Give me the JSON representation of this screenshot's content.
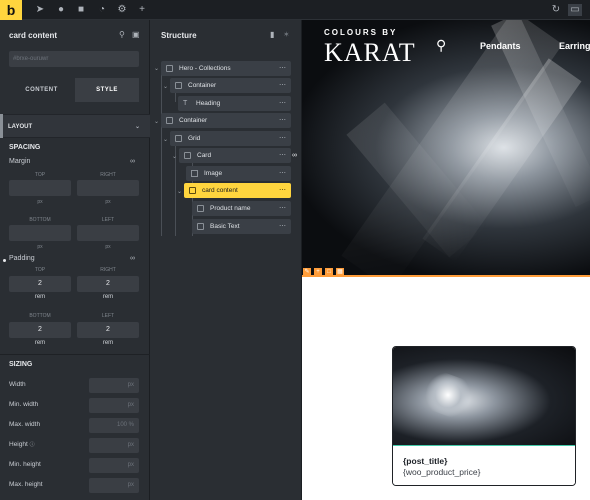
{
  "app": {
    "logo": "b"
  },
  "topbar": {
    "icons": [
      "cursor-icon",
      "help-icon",
      "page-icon",
      "history-icon",
      "settings-icon",
      "add-icon",
      "undo-icon",
      "desktop-icon"
    ]
  },
  "left": {
    "title": "card content",
    "id_placeholder": "#brxe-ouruwr",
    "tabs": {
      "content": "CONTENT",
      "style": "STYLE"
    },
    "layout": "LAYOUT",
    "spacing": "SPACING",
    "margin": "Margin",
    "padding": "Padding",
    "top": "TOP",
    "right": "RIGHT",
    "bottom": "BOTTOM",
    "left": "LEFT",
    "px": "px",
    "padding_top": "2",
    "padding_right": "2",
    "padding_bottom": "2",
    "padding_left": "2",
    "unit": "rem",
    "sizing": "SIZING",
    "sizing_fields": [
      {
        "label": "Width",
        "value": "px"
      },
      {
        "label": "Min. width",
        "value": "px"
      },
      {
        "label": "Max. width",
        "value": "100    %"
      },
      {
        "label": "Height",
        "value": "px"
      },
      {
        "label": "Min. height",
        "value": "px"
      },
      {
        "label": "Max. height",
        "value": "px"
      }
    ]
  },
  "structure": {
    "title": "Structure",
    "nodes": [
      "Hero - Collections",
      "Container",
      "Heading",
      "Container",
      "Grid",
      "Card",
      "Image",
      "card content",
      "Product name",
      "Basic Text"
    ]
  },
  "canvas": {
    "brand_top": "COLOURS BY",
    "brand_main": "KARAT",
    "nav_items": [
      "Pendants",
      "Earring"
    ],
    "card_title": "{post_title}",
    "card_price": "{woo_product_price}"
  },
  "colors": {
    "accent": "#ffd53e",
    "selected_border": "#43c9a8",
    "canvas_outline": "#ff9d3a"
  }
}
